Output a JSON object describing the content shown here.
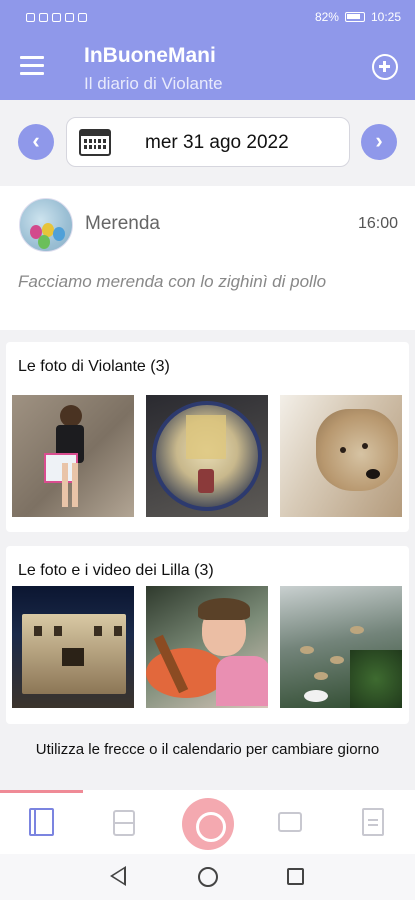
{
  "status_bar": {
    "battery": "82%",
    "time": "10:25"
  },
  "app": {
    "title": "InBuoneMani",
    "subtitle": "Il diario di Violante"
  },
  "date_nav": {
    "date": "mer 31 ago 2022",
    "prev_glyph": "‹",
    "next_glyph": "›"
  },
  "event": {
    "name": "Merenda",
    "time": "16:00",
    "description": "Facciamo merenda con lo zighinì di pollo"
  },
  "sections": [
    {
      "heading": "Le foto di Violante (3)",
      "photo_count": 3
    },
    {
      "heading": "Le foto e i video dei Lilla (3)",
      "photo_count": 3
    }
  ],
  "hint": "Utilizza le frecce o il calendario per cambiare giorno",
  "tabs": [
    {
      "icon": "diary-icon",
      "active": true
    },
    {
      "icon": "cards-icon",
      "active": false
    },
    {
      "icon": "baby-face-icon",
      "active": false
    },
    {
      "icon": "chat-icon",
      "active": false
    },
    {
      "icon": "document-icon",
      "active": false
    }
  ],
  "colors": {
    "primary": "#8f98ea",
    "accent": "#f4a9b0",
    "indicator": "#ef8a96"
  }
}
